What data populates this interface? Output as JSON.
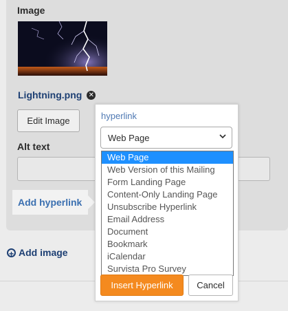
{
  "image_section": {
    "label": "Image",
    "file_name": "Lightning.png",
    "remove_icon": "close-circle-icon",
    "edit_button": "Edit Image",
    "alt_label": "Alt text",
    "alt_value": ""
  },
  "add_hyperlink": {
    "label": "Add hyperlink"
  },
  "add_image": {
    "label": "Add image",
    "icon": "plus-circle-icon"
  },
  "hyperlink_popup": {
    "label": "hyperlink",
    "selected": "Web Page",
    "options": [
      "Web Page",
      "Web Version of this Mailing",
      "Form Landing Page",
      "Content-Only Landing Page",
      "Unsubscribe Hyperlink",
      "Email Address",
      "Document",
      "Bookmark",
      "iCalendar",
      "Survista Pro Survey"
    ],
    "insert_button": "Insert Hyperlink",
    "cancel_button": "Cancel"
  },
  "colors": {
    "accent_orange": "#f48a1f",
    "link_blue": "#3a6fb0",
    "selection_blue": "#1e90ff",
    "dark_navy": "#1d3f73"
  }
}
